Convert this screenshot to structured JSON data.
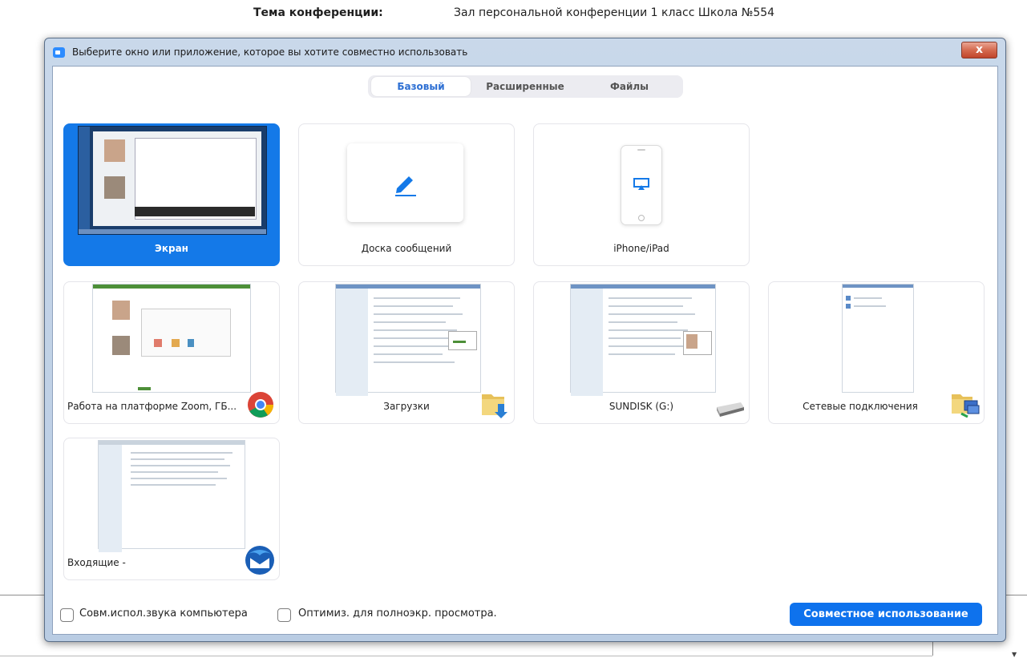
{
  "meeting": {
    "topic_label": "Тема конференции:",
    "topic_value": "Зал персональной конференции 1 класс Школа №554"
  },
  "dialog": {
    "title": "Выберите окно или приложение, которое вы хотите совместно использовать",
    "close_label": "x"
  },
  "tabs": [
    {
      "label": "Базовый",
      "active": true
    },
    {
      "label": "Расширенные",
      "active": false
    },
    {
      "label": "Файлы",
      "active": false
    }
  ],
  "tiles": [
    {
      "label": "Экран",
      "selected": true,
      "icon": "desktop-screenshot"
    },
    {
      "label": "Доска сообщений",
      "selected": false,
      "icon": "pencil-icon"
    },
    {
      "label": "iPhone/iPad",
      "selected": false,
      "icon": "airplay-phone-icon"
    },
    {
      "label": "Работа на платформе Zoom, ГБ...",
      "selected": false,
      "icon": "chrome-icon"
    },
    {
      "label": "Загрузки",
      "selected": false,
      "icon": "folder-download-icon"
    },
    {
      "label": "SUNDISK (G:)",
      "selected": false,
      "icon": "drive-icon"
    },
    {
      "label": "Сетевые подключения",
      "selected": false,
      "icon": "network-folder-icon"
    },
    {
      "label": "Входящие -",
      "selected": false,
      "icon": "thunderbird-icon"
    }
  ],
  "footer": {
    "computer_sound": {
      "label": "Совм.испол.звука компьютера",
      "checked": false
    },
    "optimize_video": {
      "label": "Оптимиз. для полноэкр. просмотра.",
      "checked": false
    },
    "share_button": "Совместное использование"
  },
  "colors": {
    "accent": "#0e72ed",
    "selected_tile": "#1479e8",
    "close_button": "#c0452b"
  }
}
